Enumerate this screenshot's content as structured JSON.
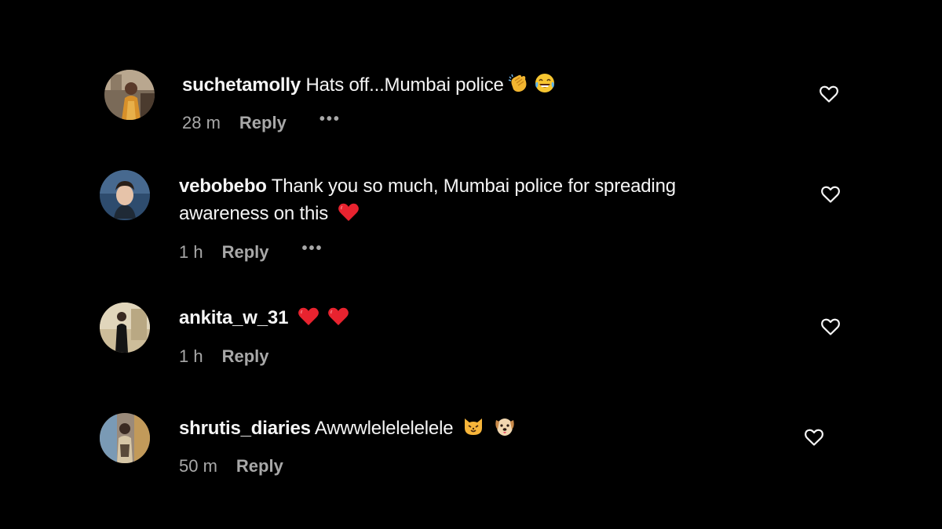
{
  "colors": {
    "background": "#000000",
    "text": "#f5f5f5",
    "secondary": "#a8a8a8",
    "emoji_heart": "#e8232f"
  },
  "comments": [
    {
      "username": "suchetamolly",
      "text": "Hats off...Mumbai police",
      "emojis": [
        "clapping-hands-emoji",
        "tears-of-joy-emoji"
      ],
      "time": "28 m",
      "reply": "Reply",
      "more": "•••"
    },
    {
      "username": "vebobebo",
      "text": "Thank you so much, Mumbai police for spreading",
      "text_line2": "awareness on this",
      "emojis": [
        "red-heart-emoji"
      ],
      "time": "1 h",
      "reply": "Reply",
      "more": "•••"
    },
    {
      "username": "ankita_w_31",
      "text": "",
      "emojis": [
        "red-heart-emoji",
        "red-heart-emoji"
      ],
      "time": "1 h",
      "reply": "Reply"
    },
    {
      "username": "shrutis_diaries",
      "text": "Awwwlelelelelele",
      "emojis": [
        "cat-face-emoji",
        "dog-face-emoji"
      ],
      "time": "50 m",
      "reply": "Reply"
    }
  ]
}
